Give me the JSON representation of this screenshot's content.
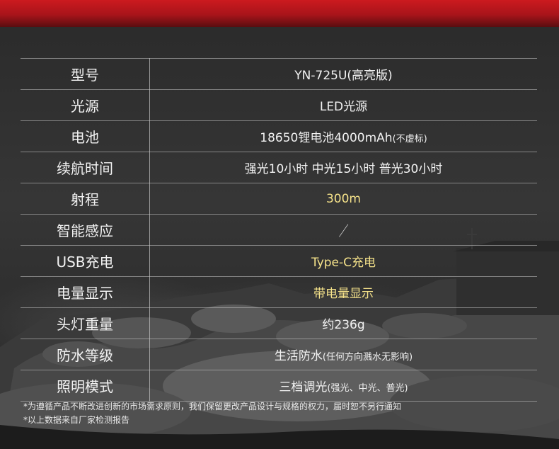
{
  "specs": [
    {
      "key": "型号",
      "value": "YN-725U(高亮版)"
    },
    {
      "key": "光源",
      "value": "LED光源"
    },
    {
      "key": "电池",
      "value": "18650锂电池4000mAh",
      "note": "(不虚标)"
    },
    {
      "key": "续航时间",
      "value": "强光10小时 中光15小时 普光30小时"
    },
    {
      "key": "射程",
      "value": "300m"
    },
    {
      "key": "智能感应",
      "value": "／"
    },
    {
      "key": "USB充电",
      "value": "Type-C充电"
    },
    {
      "key": "电量显示",
      "value": "带电量显示"
    },
    {
      "key": "头灯重量",
      "value": "约236g"
    },
    {
      "key": "防水等级",
      "value": "生活防水",
      "note": "(任何方向溅水无影响)"
    },
    {
      "key": "照明模式",
      "value": "三档调光",
      "note": "(强光、中光、普光)"
    }
  ],
  "notes": [
    "*为遵循产品不断改进创新的市场需求原则，我们保留更改产品设计与规格的权力，届时恕不另行通知",
    "*以上数据来自厂家检测报告"
  ],
  "colors": {
    "accent_red": "#c8191e",
    "highlight": "#f5e28a"
  }
}
